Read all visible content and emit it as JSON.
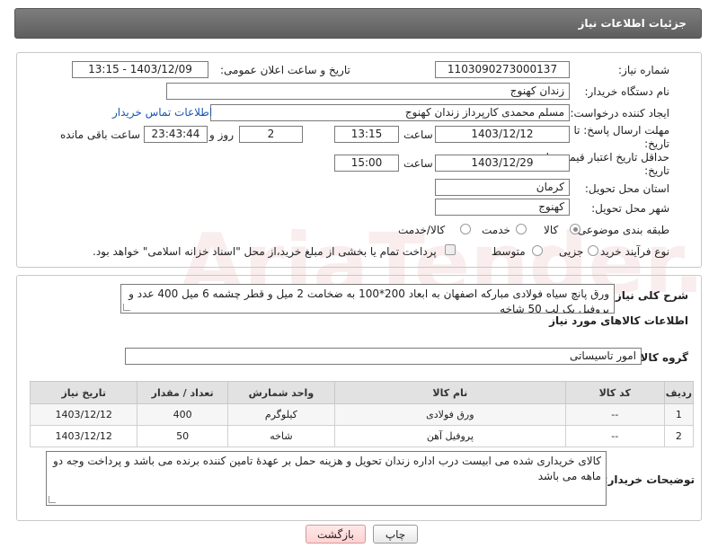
{
  "header": {
    "title": "جزئیات اطلاعات نیاز"
  },
  "form": {
    "need_number_label": "شماره نیاز:",
    "need_number": "1103090273000137",
    "announce_label": "تاریخ و ساعت اعلان عمومی:",
    "announce_value": "1403/12/09 - 13:15",
    "buyer_org_label": "نام دستگاه خریدار:",
    "buyer_org": "زندان کهنوج",
    "creator_label": "ایجاد کننده درخواست:",
    "creator": "مسلم محمدی کارپرداز زندان کهنوج",
    "contact_link": "اطلاعات تماس خریدار",
    "deadline_label_1": "مهلت ارسال پاسخ: تا",
    "deadline_label_2": "تاریخ:",
    "deadline_date": "1403/12/12",
    "time_label": "ساعت",
    "deadline_time": "13:15",
    "days_value": "2",
    "days_label": "روز و",
    "remaining_time": "23:43:44",
    "remaining_label": "ساعت باقی مانده",
    "validity_label_1": "حداقل تاریخ اعتبار قیمت: تا",
    "validity_label_2": "تاریخ:",
    "validity_date": "1403/12/29",
    "validity_time": "15:00",
    "province_label": "استان محل تحویل:",
    "province": "کرمان",
    "city_label": "شهر محل تحویل:",
    "city": "کهنوج",
    "category_label": "طبقه بندی موضوعی:",
    "category_options": [
      "کالا",
      "خدمت",
      "کالا/خدمت"
    ],
    "process_label": "نوع فرآیند خرید :",
    "process_options": [
      "جزیی",
      "متوسط"
    ],
    "payment_note": "پرداخت تمام یا بخشی از مبلغ خرید،از محل \"اسناد خزانه اسلامی\" خواهد بود."
  },
  "details": {
    "general_desc_label": "شرح کلی نیاز:",
    "general_desc": "ورق پانچ سیاه  فولادی مبارکه اصفهان به ابعاد 200*100 به ضخامت 2 میل و قطر چشمه 6 میل 400 عدد و پروفیل یک لب 50 شاخه",
    "goods_info_title": "اطلاعات کالاهای مورد نیاز",
    "goods_group_label": "گروه کالا:",
    "goods_group": "امور تاسیساتی",
    "table": {
      "headers": [
        "ردیف",
        "کد کالا",
        "نام کالا",
        "واحد شمارش",
        "تعداد / مقدار",
        "تاریخ نیاز"
      ],
      "rows": [
        [
          "1",
          "--",
          "ورق فولادی",
          "کیلوگرم",
          "400",
          "1403/12/12"
        ],
        [
          "2",
          "--",
          "پروفیل آهن",
          "شاخه",
          "50",
          "1403/12/12"
        ]
      ]
    },
    "buyer_notes_label": "توضیحات خریدار:",
    "buyer_notes": "کالای خریداری شده می ابیست درب اداره زندان تحویل و هزینه حمل بر عهدۀ تامین کننده برنده می باشد و پرداخت وجه دو ماهه می باشد"
  },
  "buttons": {
    "print": "چاپ",
    "back": "بازگشت"
  },
  "watermark": {
    "text": "AriaTender.neT"
  }
}
